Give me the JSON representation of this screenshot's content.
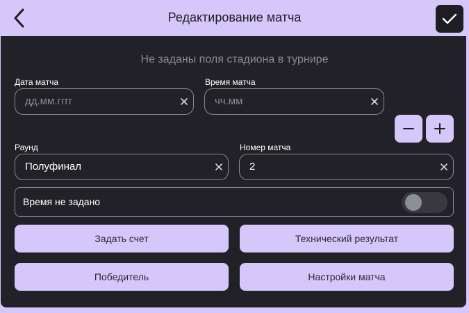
{
  "header": {
    "title": "Редактирование матча",
    "back_icon": "chevron-left-icon",
    "confirm_icon": "check-icon"
  },
  "notice": "Не заданы поля стадиона в турнире",
  "date_field": {
    "label": "Дата матча",
    "placeholder": "дд.мм.гггг"
  },
  "time_field": {
    "label": "Время матча",
    "placeholder": "чч.мм"
  },
  "stepper": {
    "minus_icon": "minus-icon",
    "plus_icon": "plus-icon"
  },
  "round_field": {
    "label": "Раунд",
    "value": "Полуфинал"
  },
  "match_number_field": {
    "label": "Номер матча",
    "value": "2"
  },
  "time_not_set": {
    "label": "Время не задано",
    "enabled": false
  },
  "buttons": {
    "set_score": "Задать счет",
    "technical_result": "Технический результат",
    "winner": "Победитель",
    "match_settings": "Настройки матча"
  },
  "colors": {
    "accent": "#d6c7fb",
    "panel": "#222127",
    "dark": "#1e1d23",
    "border": "#8a8990",
    "muted_text": "#8a8990"
  }
}
